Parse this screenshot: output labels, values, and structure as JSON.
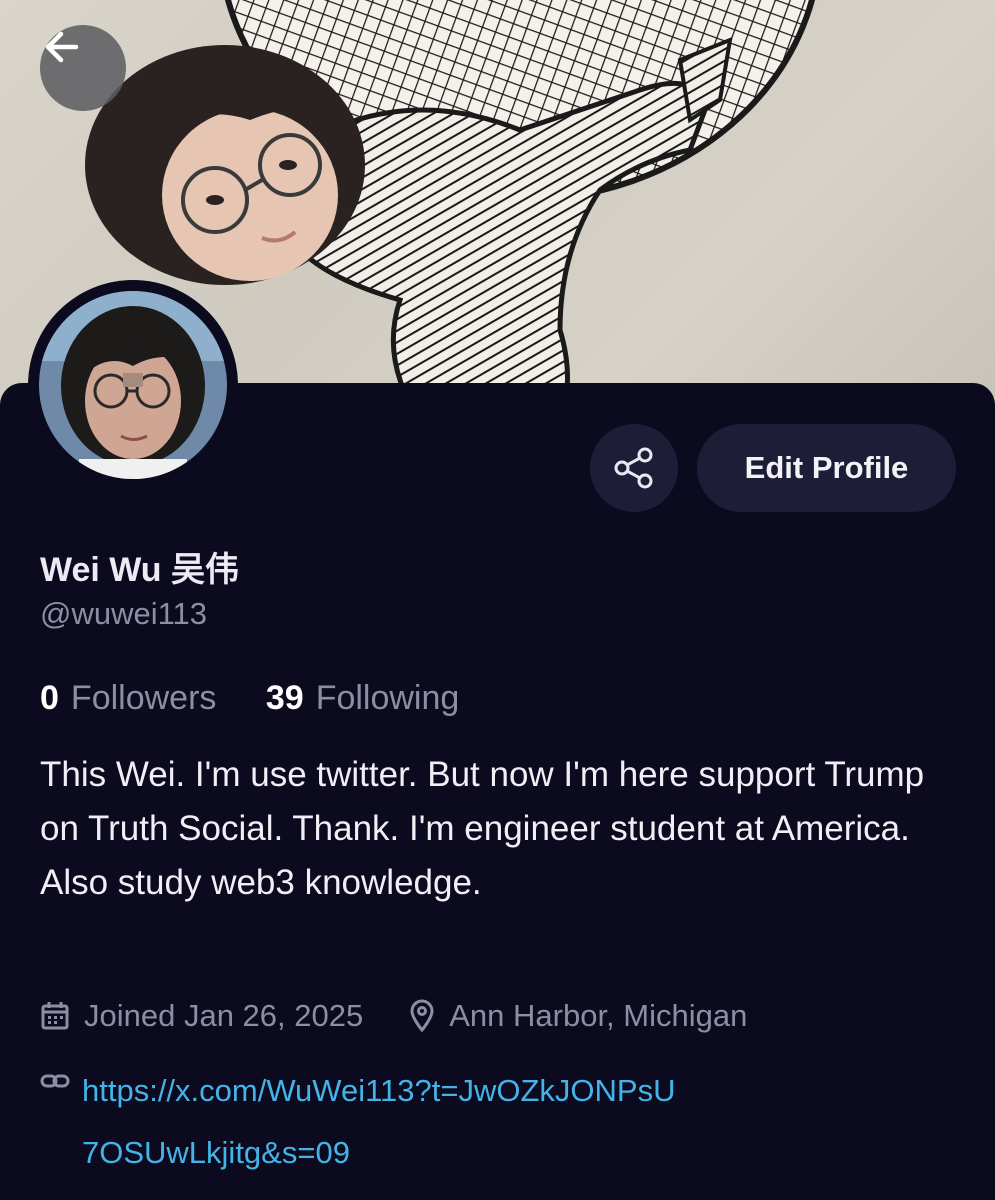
{
  "profile": {
    "display_name": "Wei Wu 吴伟",
    "handle": "@wuwei113",
    "followers_count": "0",
    "followers_label": "Followers",
    "following_count": "39",
    "following_label": "Following",
    "bio": "This Wei. I'm use twitter. But now I'm here support Trump on Truth Social. Thank. I'm engineer student at America. Also study web3 knowledge.",
    "joined": "Joined Jan 26, 2025",
    "location": "Ann Harbor, Michigan",
    "website": "https://x.com/WuWei113?t=JwOZkJONPsU7OSUwLkjitg&s=09"
  },
  "actions": {
    "edit_profile_label": "Edit Profile"
  },
  "icons": {
    "back": "arrow-left-icon",
    "share": "share-icon",
    "calendar": "calendar-icon",
    "location": "map-pin-icon",
    "link": "link-icon"
  },
  "colors": {
    "background": "#0b0a1e",
    "button_bg": "#1e1d38",
    "muted_text": "#8e8da3",
    "link": "#43b3e8"
  }
}
